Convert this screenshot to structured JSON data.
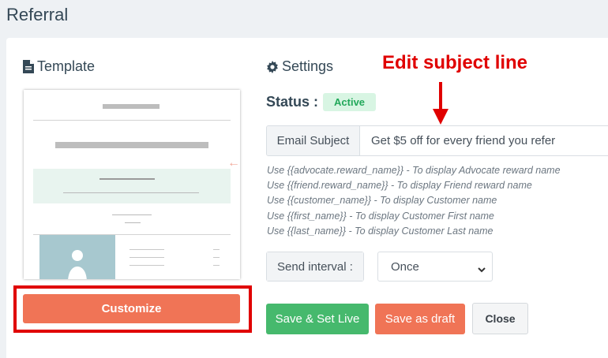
{
  "page": {
    "title": "Referral"
  },
  "template": {
    "heading": "Template",
    "customize_label": "Customize"
  },
  "settings": {
    "heading": "Settings",
    "status_label": "Status :",
    "status_value": "Active",
    "subject_label": "Email Subject",
    "subject_value": "Get $5 off for every friend you refer",
    "help_lines": [
      "Use {{advocate.reward_name}} - To display Advocate reward name",
      "Use {{friend.reward_name}} - To display Friend reward name",
      "Use {{customer_name}} - To display Customer name",
      "Use {{first_name}} - To display Customer First name",
      "Use {{last_name}} - To display Customer Last name"
    ],
    "interval_label": "Send interval :",
    "interval_value": "Once",
    "save_live_label": "Save & Set Live",
    "save_draft_label": "Save as draft",
    "close_label": "Close"
  },
  "annotation": {
    "text": "Edit subject line"
  },
  "colors": {
    "accent": "#f07456",
    "success": "#46b96d",
    "annotation": "#e00000"
  },
  "icons": [
    "file-icon",
    "gear-icon",
    "arrow-left-icon",
    "chevron-down-icon",
    "user-icon"
  ]
}
